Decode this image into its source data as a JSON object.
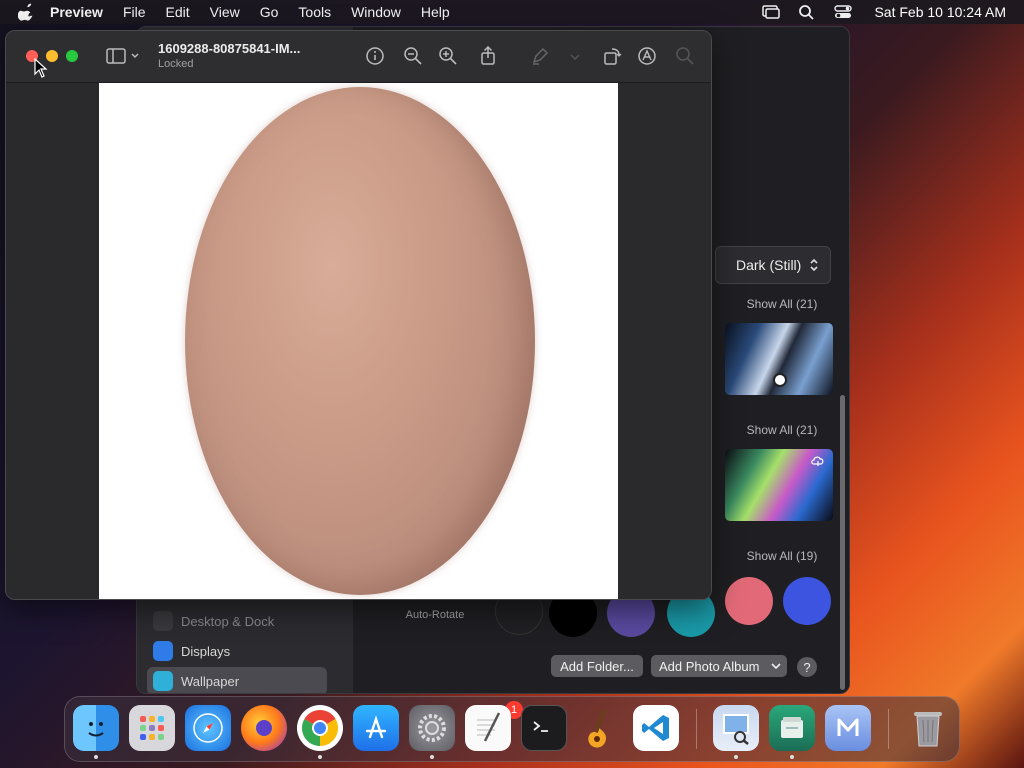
{
  "menubar": {
    "app_name": "Preview",
    "items": [
      "File",
      "Edit",
      "View",
      "Go",
      "Tools",
      "Window",
      "Help"
    ],
    "clock": "Sat Feb 10  10:24 AM"
  },
  "preview": {
    "title": "1609288-80875841-IM...",
    "subtitle": "Locked"
  },
  "settings": {
    "sidebar": {
      "items": [
        {
          "label": "Desktop & Dock"
        },
        {
          "label": "Displays"
        },
        {
          "label": "Wallpaper"
        }
      ]
    },
    "style_select": "Dark (Still)",
    "show_all_1": "Show All (21)",
    "show_all_2": "Show All (21)",
    "show_all_3": "Show All (19)",
    "auto_rotate": "Auto-Rotate",
    "add_folder": "Add Folder...",
    "add_photo_album": "Add Photo Album",
    "help": "?"
  },
  "dock": {
    "badge_count": "1",
    "apps": [
      "finder-icon",
      "launchpad-icon",
      "safari-icon",
      "firefox-icon",
      "chrome-icon",
      "app-store-icon",
      "system-settings-icon",
      "textedit-icon",
      "terminal-icon",
      "garageband-icon",
      "vscode-icon",
      "preview-icon",
      "archive-icon",
      "m-app-icon",
      "trash-icon"
    ]
  },
  "colors": {
    "close": "#ff5f57",
    "minimize": "#febc2e",
    "maximize": "#28c840",
    "swatch_pink": "#e26a78",
    "swatch_blue": "#3d54e0"
  }
}
